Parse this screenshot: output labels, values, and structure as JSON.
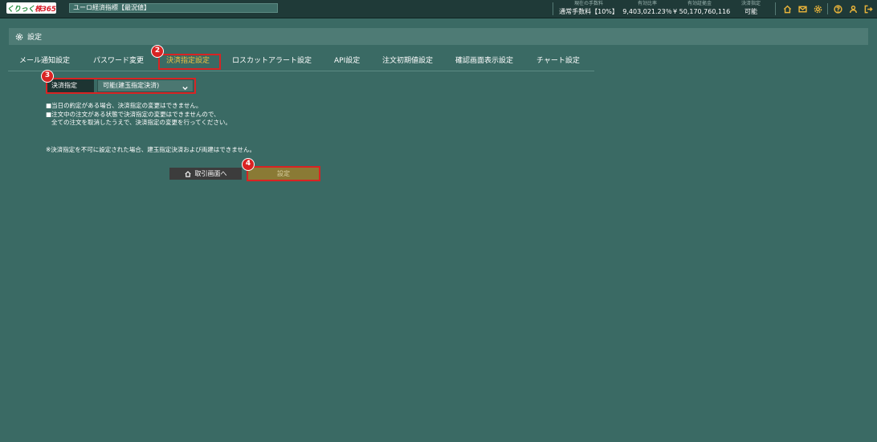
{
  "topbar": {
    "logo_prefix": "くりっく",
    "logo_main": "株365",
    "instrument": "ユーロ経済指標【最況値】",
    "stats": [
      {
        "label": "現在の手数料",
        "value": "通常手数料【10%】"
      },
      {
        "label": "有効比率",
        "value": "9,403,021.23％"
      },
      {
        "label": "有効証拠金",
        "value": "¥ 50,170,760,116"
      },
      {
        "label": "決済指定",
        "value": "可能"
      }
    ],
    "icons": [
      "home-icon",
      "mail-icon",
      "gear-icon",
      "help-icon",
      "user-icon",
      "logout-icon"
    ]
  },
  "header": {
    "title": "設定"
  },
  "tabs": [
    {
      "label": "メール通知設定"
    },
    {
      "label": "パスワード変更"
    },
    {
      "label": "決済指定設定"
    },
    {
      "label": "ロスカットアラート設定"
    },
    {
      "label": "API設定"
    },
    {
      "label": "注文初期値設定"
    },
    {
      "label": "確認画面表示設定"
    },
    {
      "label": "チャート設定"
    }
  ],
  "active_tab": "決済指定設定",
  "form": {
    "label": "決済指定",
    "selected": "可能(建玉指定決済)"
  },
  "notes": [
    "■当日の約定がある場合、決済指定の変更はできません。",
    "■注文中の注文がある状態で決済指定の変更はできませんので、",
    "全ての注文を取消したうえで、決済指定の変更を行ってください。"
  ],
  "warning": "※決済指定を不可に設定された場合、建玉指定決済および両建はできません。",
  "buttons": {
    "back_label": "取引画面へ",
    "set_label": "設定"
  },
  "badges": [
    "2",
    "3",
    "4"
  ],
  "colors": {
    "background": "#3a6a64",
    "active_tab": "#f0c040",
    "highlight": "#d92323",
    "set_button": "#8a7a35"
  }
}
